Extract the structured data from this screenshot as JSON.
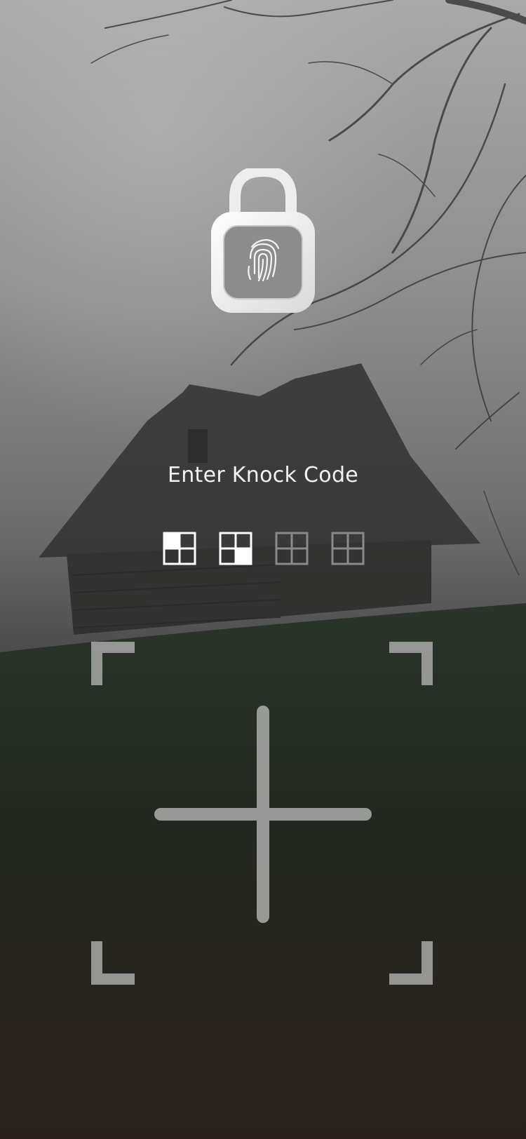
{
  "screen": {
    "title": "Enter Knock Code"
  },
  "knock_code": {
    "entered_count": 2,
    "total_slots": 4,
    "taps": [
      "top-left",
      "bottom-right"
    ]
  },
  "colors": {
    "indicator_filled": "#ffffff",
    "indicator_empty": "#8a8a8a",
    "pad_lines": "#b5b5b5"
  },
  "icons": {
    "lock": "padlock-open-icon",
    "fingerprint": "fingerprint-icon"
  }
}
